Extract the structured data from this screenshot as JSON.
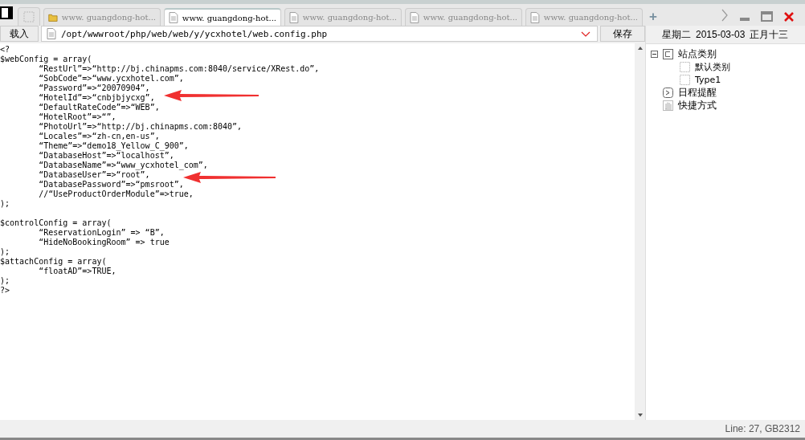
{
  "tabs": [
    {
      "label": "www. guangdong-hot...",
      "kind": "folder",
      "selected": false
    },
    {
      "label": "www. guangdong-hot...",
      "kind": "file",
      "selected": true
    },
    {
      "label": "www. guangdong-hot...",
      "kind": "file",
      "selected": false
    },
    {
      "label": "www. guangdong-hot...",
      "kind": "file",
      "selected": false
    },
    {
      "label": "www. guangdong-hot...",
      "kind": "file",
      "selected": false
    }
  ],
  "new_tab": "+",
  "toolbar": {
    "load_button": "载入",
    "path": "/opt/wwwroot/php/web/web/y/ycxhotel/web.config.php",
    "save_button": "保存"
  },
  "date_header": {
    "weekday": "星期二",
    "date": "2015-03-03",
    "lunar": "正月十三"
  },
  "code_blocks": [
    [
      "<?",
      "$webConfig = array(",
      "        “RestUrl”=>“http://bj.chinapms.com:8040/service/XRest.do”,",
      "        “SobCode”=>“www.ycxhotel.com”,",
      "        “Password”=>“20070904”,",
      "        “HotelId”=>“cnbjbjycxg”,",
      "        “DefaultRateCode”=>“WEB”,",
      "        “HotelRoot”=>“”,",
      "        “PhotoUrl”=>“http://bj.chinapms.com:8040”,",
      "        “Locales”=>“zh-cn,en-us”,",
      "        “Theme”=>“demo18_Yellow_C_900”,",
      "        “DatabaseHost”=>“localhost”,",
      "        “DatabaseName”=>“www_ycxhotel_com”,",
      "        “DatabaseUser”=>“root”,",
      "        “DatabasePassword”=>“pmsroot”,",
      "        //“UseProductOrderModule”=>true,",
      ");"
    ],
    [
      "$controlConfig = array(",
      "        “ReservationLogin” => “B”,",
      "        “HideNoBookingRoom” => true",
      ");",
      "$attachConfig = array(",
      "        “floatAD”=>TRUE,",
      ");",
      "?>"
    ]
  ],
  "sidebar": {
    "items": [
      {
        "label": "站点类别",
        "kind": "category",
        "expanded": true,
        "children": [
          {
            "label": "默认类别",
            "kind": "leaf"
          },
          {
            "label": "Type1",
            "kind": "leaf"
          }
        ]
      },
      {
        "label": "日程提醒",
        "kind": "schedule"
      },
      {
        "label": "快捷方式",
        "kind": "shortcut"
      }
    ]
  },
  "status_bar": "Line: 27, GB2312"
}
